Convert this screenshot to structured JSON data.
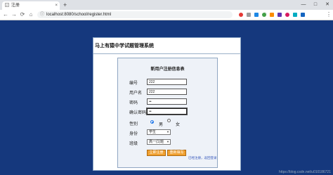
{
  "browser": {
    "tab_title": "注册",
    "tab_close": "×",
    "new_tab": "+",
    "window_controls": {
      "minimize": "—",
      "maximize": "□",
      "close": "✕"
    },
    "nav": {
      "back": "←",
      "forward": "→",
      "reload": "⟳",
      "home": "⌂"
    },
    "url": "localhost:8080/school/register.html",
    "star": "☆",
    "menu": "⋮",
    "extension_colors": [
      "#e53935",
      "#9e9e9e",
      "#1e88e5",
      "#43a047",
      "#fb8c00",
      "#5e35b1",
      "#d81b60",
      "#00acc1",
      "#1565c0"
    ]
  },
  "page": {
    "system_title": "马上有猿中学试题管理系统",
    "form_heading": "新用户注册信息表",
    "fields": {
      "id": {
        "label": "编号",
        "value": "222"
      },
      "username": {
        "label": "用户名",
        "value": "222"
      },
      "password": {
        "label": "密码",
        "value": "••"
      },
      "confirm": {
        "label": "确认密码",
        "value": "••"
      }
    },
    "gender": {
      "label": "性别",
      "options": [
        "男",
        "女"
      ],
      "selected": "男"
    },
    "role": {
      "label": "身份",
      "selected": "学生"
    },
    "class": {
      "label": "班级",
      "selected": "高一(1)班"
    },
    "buttons": {
      "register": "立即注册",
      "reset": "重新填写"
    },
    "login_link": "已经注册，返回登录",
    "watermark": "https://blog.csdn.net/u010186721"
  }
}
